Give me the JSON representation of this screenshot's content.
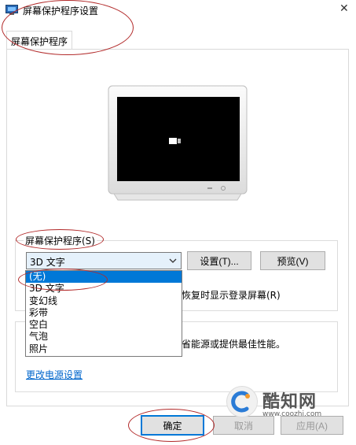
{
  "window": {
    "title": "屏幕保护程序设置",
    "close_glyph": "✕"
  },
  "tabs": [
    {
      "label": "屏幕保护程序"
    }
  ],
  "screensaver": {
    "group_label": "屏幕保护程序(S)",
    "selected": "3D 文字",
    "settings_button": "设置(T)...",
    "preview_button": "预览(V)",
    "resume_text": "恢复时显示登录屏幕(R)",
    "options": [
      "(无)",
      "3D 文字",
      "变幻线",
      "彩带",
      "空白",
      "气泡",
      "照片"
    ],
    "highlighted_index": 0
  },
  "power": {
    "partial_text": "省能源或提供最佳性能。",
    "link": "更改电源设置"
  },
  "footer": {
    "ok": "确定",
    "cancel": "取消",
    "apply": "应用(A)"
  },
  "watermark": {
    "brand": "酷知网",
    "url": "www.coozhi.com"
  },
  "colors": {
    "selection": "#0078d7",
    "annotation": "#b22a2a",
    "link": "#0066cc"
  }
}
